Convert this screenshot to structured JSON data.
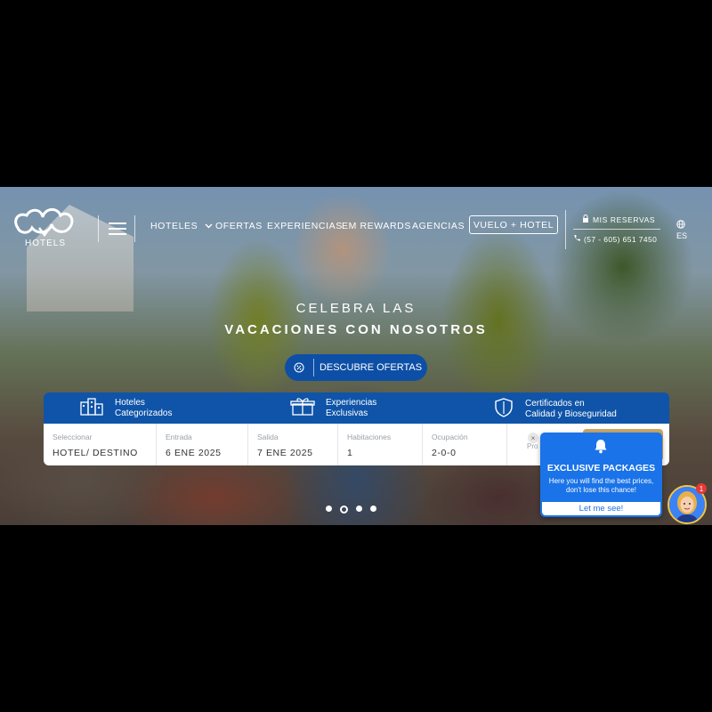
{
  "header": {
    "logo_text": "HOTELS",
    "nav": [
      "HOTELES",
      "OFERTAS",
      "EXPERIENCIAS",
      "EM REWARDS",
      "AGENCIAS"
    ],
    "vuelo_hotel": "VUELO + HOTEL",
    "reservas": "MIS RESERVAS",
    "phone": "(57 - 605) 651 7450",
    "language": "ES"
  },
  "hero": {
    "line1": "CELEBRA LAS",
    "line2": "VACACIONES CON NOSOTROS",
    "cta": "DESCUBRE OFERTAS"
  },
  "features": [
    {
      "line1": "Hoteles",
      "line2": "Categorizados",
      "icon": "buildings-icon"
    },
    {
      "line1": "Experiencias",
      "line2": "Exclusivas",
      "icon": "gift-icon"
    },
    {
      "line1": "Certificados en",
      "line2": "Calidad y Bioseguridad",
      "icon": "shield-icon"
    }
  ],
  "booking": {
    "destination": {
      "label": "Seleccionar",
      "value": "HOTEL/ DESTINO"
    },
    "checkin": {
      "label": "Entrada",
      "value": "6 ENE 2025"
    },
    "checkout": {
      "label": "Salida",
      "value": "7 ENE 2025"
    },
    "rooms": {
      "label": "Habitaciones",
      "value": "1"
    },
    "occupancy": {
      "label": "Ocupación",
      "value": "2-0-0"
    },
    "promo_label": "Pro",
    "promo_close": "×"
  },
  "carousel": {
    "slides": 4,
    "active": 2
  },
  "popup": {
    "title": "EXCLUSIVE PACKAGES",
    "body": "Here you will find the best prices, don't lose this chance!",
    "link": "Let me see!",
    "badge": "1"
  },
  "colors": {
    "brand_blue": "#0f54a8",
    "popup_blue": "#1a73e8",
    "gold": "#c9a86a"
  }
}
